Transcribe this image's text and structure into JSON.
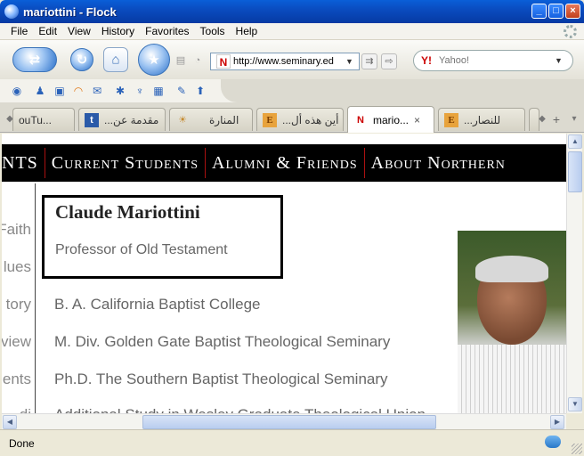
{
  "window": {
    "title": "mariottini - Flock"
  },
  "menu": {
    "items": [
      {
        "key": "F",
        "rest": "ile"
      },
      {
        "key": "E",
        "rest": "dit"
      },
      {
        "key": "V",
        "rest": "iew"
      },
      {
        "key": "",
        "rest": "History",
        "u": "s",
        "pre": "Hi",
        "post": "tory"
      },
      {
        "key": "F",
        "rest": "avorites",
        "pre": "",
        "u2": "a"
      },
      {
        "key": "T",
        "rest": "ools"
      },
      {
        "key": "H",
        "rest": "elp"
      }
    ],
    "labels": [
      "File",
      "Edit",
      "View",
      "History",
      "Favorites",
      "Tools",
      "Help"
    ]
  },
  "toolbar": {
    "url": "http://www.seminary.ed",
    "search_placeholder": "Yahoo!",
    "url_favicon": "N"
  },
  "tabs": [
    {
      "label": "ouTu...",
      "icon": "youtube-icon",
      "active": false
    },
    {
      "label": "...مقدمة عن",
      "icon": "t-icon",
      "fav": "t",
      "active": false
    },
    {
      "label": "المنارة",
      "icon": "sun-icon",
      "fav": "☀",
      "active": false
    },
    {
      "label": "...أين هذه أل",
      "icon": "e-icon",
      "fav": "E",
      "active": false
    },
    {
      "label": "mario...",
      "icon": "n-icon",
      "fav": "N",
      "active": true,
      "close": "×"
    },
    {
      "label": "...للنصار",
      "icon": "e-icon",
      "fav": "E",
      "active": false
    }
  ],
  "page": {
    "nav": [
      "NTS",
      "Current Students",
      "Alumni & Friends",
      "About Northern"
    ],
    "left_menu": [
      "Faith",
      "lues",
      "tory",
      "view",
      "ents",
      "di"
    ],
    "name": "Claude Mariottini",
    "role": "Professor of Old Testament",
    "degrees": [
      "B. A. California Baptist College",
      "M. Div. Golden Gate Baptist Theological Seminary",
      "Ph.D. The Southern Baptist Theological Seminary",
      "Additional Study in Wesley Graduate Theological Union"
    ]
  },
  "status": {
    "text": "Done"
  }
}
